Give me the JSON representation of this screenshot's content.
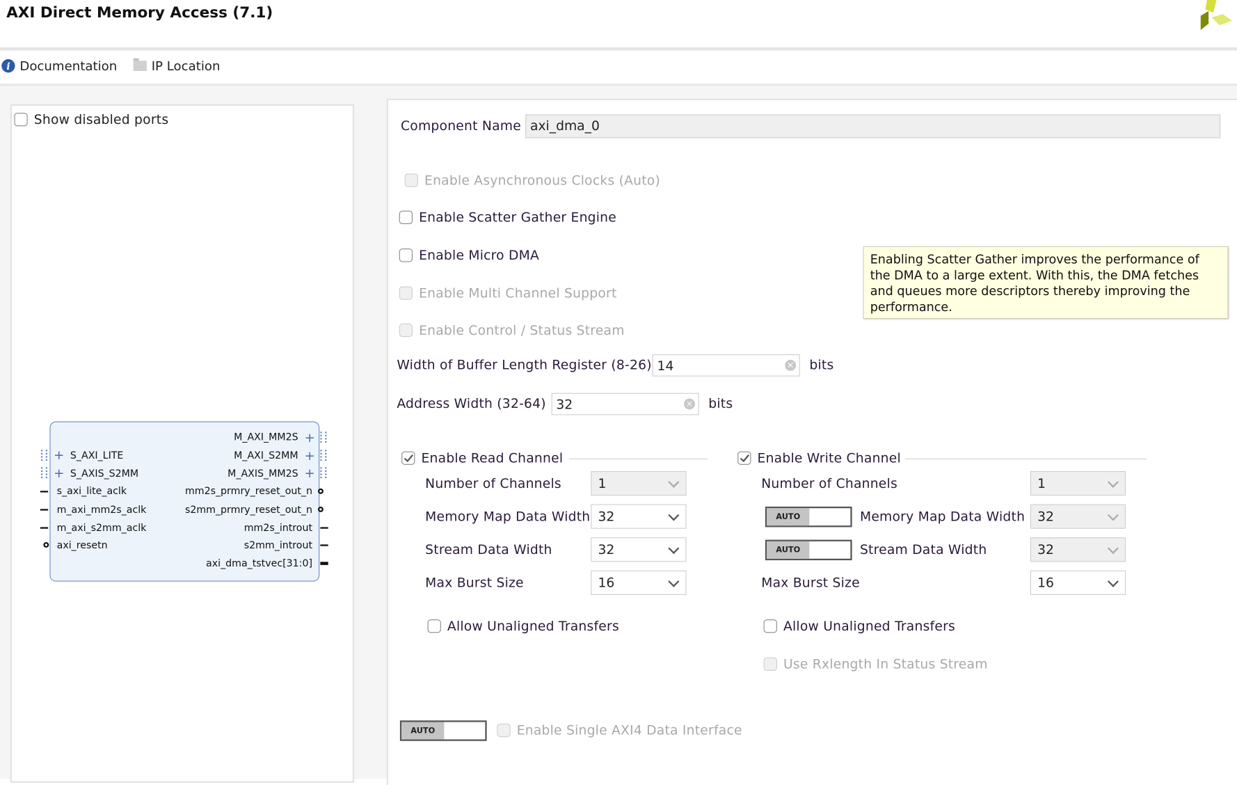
{
  "header": {
    "title": "AXI Direct Memory Access (7.1)"
  },
  "toolbar": {
    "documentation": "Documentation",
    "ip_location": "IP Location"
  },
  "left": {
    "show_disabled_ports": "Show disabled ports",
    "block": {
      "left_ports": [
        "S_AXI_LITE",
        "S_AXIS_S2MM",
        "s_axi_lite_aclk",
        "m_axi_mm2s_aclk",
        "m_axi_s2mm_aclk",
        "axi_resetn"
      ],
      "right_ports": [
        "M_AXI_MM2S",
        "M_AXI_S2MM",
        "M_AXIS_MM2S",
        "mm2s_prmry_reset_out_n",
        "s2mm_prmry_reset_out_n",
        "mm2s_introut",
        "s2mm_introut",
        "axi_dma_tstvec[31:0]"
      ]
    }
  },
  "form": {
    "component_name_label": "Component Name",
    "component_name": "axi_dma_0",
    "async_clocks": "Enable Asynchronous Clocks (Auto)",
    "scatter_gather": "Enable Scatter Gather Engine",
    "micro_dma": "Enable Micro DMA",
    "multi_channel": "Enable Multi Channel Support",
    "control_status": "Enable Control / Status Stream",
    "buffer_len_label": "Width of Buffer Length Register (8-26)",
    "buffer_len": "14",
    "bits": "bits",
    "addr_width_label": "Address Width (32-64)",
    "addr_width": "32",
    "read": {
      "title": "Enable Read Channel",
      "num_channels_label": "Number of Channels",
      "num_channels": "1",
      "mm_width_label": "Memory Map Data Width",
      "mm_width": "32",
      "stream_width_label": "Stream Data Width",
      "stream_width": "32",
      "burst_label": "Max Burst Size",
      "burst": "16",
      "unaligned": "Allow Unaligned Transfers"
    },
    "write": {
      "title": "Enable Write Channel",
      "num_channels_label": "Number of Channels",
      "num_channels": "1",
      "mm_width_label": "Memory Map Data Width",
      "mm_width": "32",
      "stream_width_label": "Stream Data Width",
      "stream_width": "32",
      "burst_label": "Max Burst Size",
      "burst": "16",
      "unaligned": "Allow Unaligned Transfers",
      "rxlength": "Use Rxlength In Status Stream"
    },
    "auto_label": "AUTO",
    "single_axi4": "Enable Single AXI4 Data Interface"
  },
  "tooltip": "Enabling Scatter Gather improves the performance of the DMA to a large extent. With this, the DMA fetches and queues more descriptors thereby improving the performance."
}
